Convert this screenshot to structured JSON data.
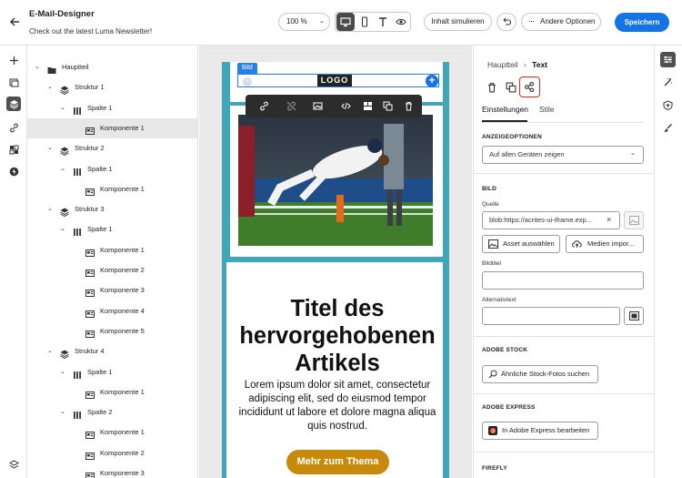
{
  "header": {
    "title": "E-Mail-Designer",
    "subtitle": "Check out the latest Luma Newsletter!",
    "zoom": "100 %",
    "simulate_label": "Inhalt simulieren",
    "more_options_label": "Andere Optionen",
    "save_label": "Speichern"
  },
  "tree": {
    "items": [
      {
        "label": "Hauptteil"
      },
      {
        "label": "Struktur 1"
      },
      {
        "label": "Spalte 1"
      },
      {
        "label": "Komponente 1"
      },
      {
        "label": "Struktur 2"
      },
      {
        "label": "Spalte 1"
      },
      {
        "label": "Komponente 1"
      },
      {
        "label": "Struktur 3"
      },
      {
        "label": "Spalte 1"
      },
      {
        "label": "Komponente 1"
      },
      {
        "label": "Komponente 2"
      },
      {
        "label": "Komponente 3"
      },
      {
        "label": "Komponente 4"
      },
      {
        "label": "Komponente 5"
      },
      {
        "label": "Struktur 4"
      },
      {
        "label": "Spalte 1"
      },
      {
        "label": "Komponente 1"
      },
      {
        "label": "Spalte 2"
      },
      {
        "label": "Komponente 1"
      },
      {
        "label": "Komponente 2"
      },
      {
        "label": "Komponente 3"
      }
    ]
  },
  "canvas": {
    "selection_tag": "Bild",
    "logo_text": "LOGO",
    "hero_title": "Titel des hervorgehobenen Artikels",
    "hero_body": "Lorem ipsum dolor sit amet, consectetur adipiscing elit, sed do eiusmod tempor incididunt ut labore et dolore magna aliqua quis nostrud.",
    "cta_label": "Mehr zum Thema"
  },
  "panel": {
    "breadcrumb_parent": "Hauptteil",
    "breadcrumb_current": "Text",
    "tabs": [
      {
        "label": "Einstellungen",
        "active": true
      },
      {
        "label": "Stile",
        "active": false
      }
    ],
    "display_options": {
      "heading": "ANZEIGEOPTIONEN",
      "selected": "Auf allen Geräten zeigen"
    },
    "image": {
      "heading": "BILD",
      "source_label": "Quelle",
      "source_value": "blob:https://acrites-ui-iframe.exp...",
      "select_asset_label": "Asset auswählen",
      "import_media_label": "Medien impor...",
      "title_label": "Bildtitel",
      "title_value": "",
      "alt_label": "Alternativtext",
      "alt_value": ""
    },
    "adobe_stock": {
      "heading": "ADOBE STOCK",
      "button_label": "Ähnliche Stock-Fotos suchen"
    },
    "adobe_express": {
      "heading": "ADOBE EXPRESS",
      "button_label": "In Adobe Express bearbeiten"
    },
    "firefly": {
      "heading": "FIREFLY"
    }
  },
  "colors": {
    "accent": "#1473e6",
    "email_frame": "#3fa7b5",
    "cta": "#c88a0b",
    "highlight_box": "#e0281e"
  }
}
